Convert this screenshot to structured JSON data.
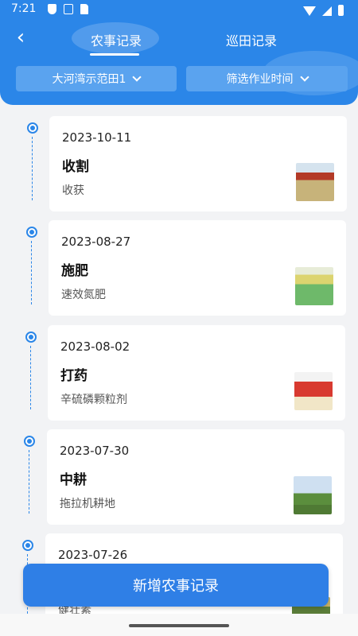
{
  "status_bar": {
    "time": "7:21"
  },
  "header": {
    "tabs": [
      {
        "label": "农事记录",
        "active": true
      },
      {
        "label": "巡田记录",
        "active": false
      }
    ],
    "filters": {
      "farm": "大河湾示范田1",
      "time": "筛选作业时间"
    }
  },
  "records": [
    {
      "date": "2023-10-11",
      "type": "收割",
      "detail": "收获",
      "image": "harvest-photo"
    },
    {
      "date": "2023-08-27",
      "type": "施肥",
      "detail": "速效氮肥",
      "image": "fertilizer-bag-photo"
    },
    {
      "date": "2023-08-02",
      "type": "打药",
      "detail": "辛硫磷颗粒剂",
      "image": "pesticide-pack-photo"
    },
    {
      "date": "2023-07-30",
      "type": "中耕",
      "detail": "拖拉机耕地",
      "image": "tractor-field-photo"
    },
    {
      "date": "2023-07-26",
      "type": "",
      "detail": "健壮素",
      "image": "field-photo"
    }
  ],
  "actions": {
    "add_record": "新增农事记录"
  },
  "colors": {
    "primary": "#2b86e8",
    "button": "#2f7fe6",
    "background": "#f2f3f5"
  }
}
